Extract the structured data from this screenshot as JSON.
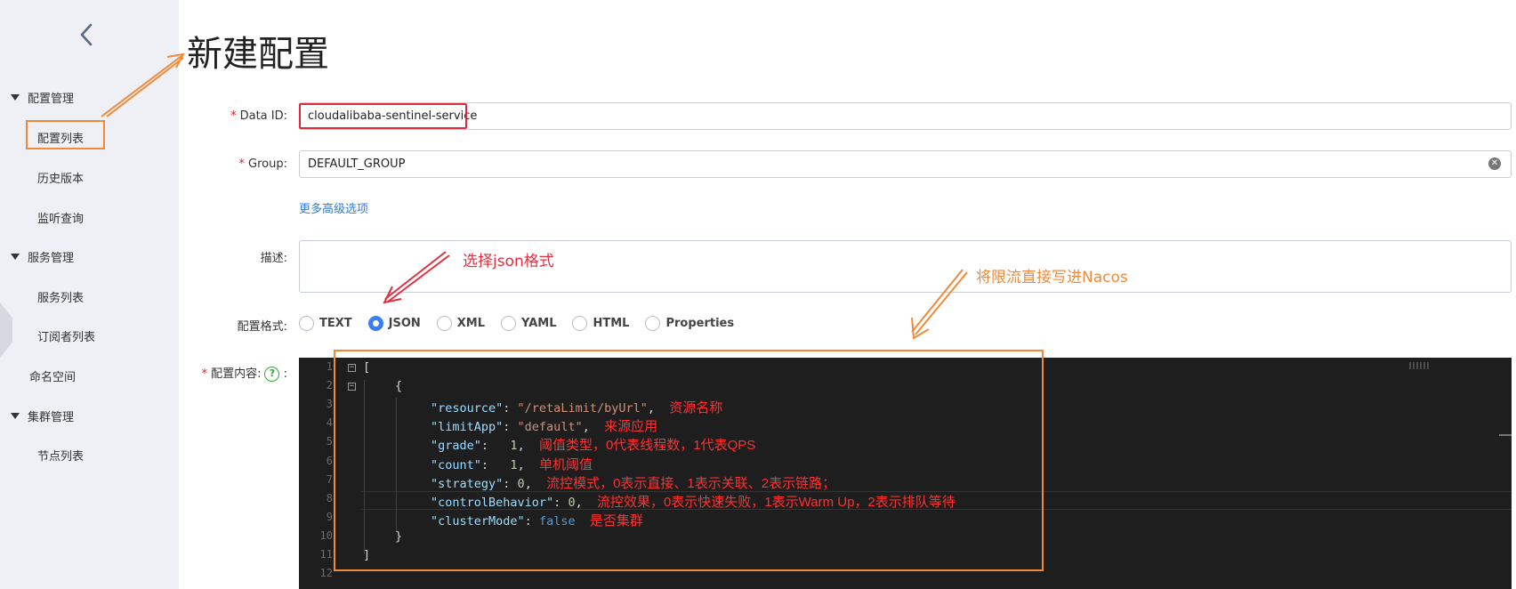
{
  "sidebar": {
    "groups": [
      {
        "label": "配置管理",
        "items": [
          "配置列表",
          "历史版本",
          "监听查询"
        ]
      },
      {
        "label": "服务管理",
        "items": [
          "服务列表",
          "订阅者列表"
        ]
      },
      {
        "label": "命名空间"
      },
      {
        "label": "集群管理",
        "items": [
          "节点列表"
        ]
      }
    ]
  },
  "page": {
    "title": "新建配置"
  },
  "form": {
    "data_id_label": "Data ID:",
    "data_id_value": "cloudalibaba-sentinel-service",
    "group_label": "Group:",
    "group_value": "DEFAULT_GROUP",
    "more_options": "更多高级选项",
    "desc_label": "描述:",
    "format_label": "配置格式:",
    "formats": [
      "TEXT",
      "JSON",
      "XML",
      "YAML",
      "HTML",
      "Properties"
    ],
    "selected_format": "JSON",
    "content_label": "配置内容:",
    "help_glyph": "?",
    "colon": ":"
  },
  "editor": {
    "line_numbers": [
      "1",
      "2",
      "3",
      "4",
      "5",
      "6",
      "7",
      "8",
      "9",
      "10",
      "11",
      "12"
    ],
    "lines": [
      {
        "t": "["
      },
      {
        "t": "{"
      },
      {
        "key": "\"resource\"",
        "sep": ": ",
        "val": "\"/retaLimit/byUrl\"",
        "vc": "str",
        "end": ",",
        "c": "资源名称"
      },
      {
        "key": "\"limitApp\"",
        "sep": ": ",
        "val": "\"default\"",
        "vc": "str",
        "end": ",",
        "c": "来源应用"
      },
      {
        "key": "\"grade\"",
        "sep": ":   ",
        "val": "1",
        "vc": "num",
        "end": ",",
        "c": "阈值类型，0代表线程数，1代表QPS"
      },
      {
        "key": "\"count\"",
        "sep": ":   ",
        "val": "1",
        "vc": "num",
        "end": ",",
        "c": "单机阈值"
      },
      {
        "key": "\"strategy\"",
        "sep": ": ",
        "val": "0",
        "vc": "num",
        "end": ",",
        "c": "流控模式，0表示直接、1表示关联、2表示链路；"
      },
      {
        "key": "\"controlBehavior\"",
        "sep": ": ",
        "val": "0",
        "vc": "num",
        "end": ",",
        "c": "流控效果，0表示快速失败，1表示Warm Up，2表示排队等待"
      },
      {
        "key": "\"clusterMode\"",
        "sep": ": ",
        "val": "false",
        "vc": "kw",
        "end": "",
        "c": "是否集群"
      },
      {
        "t": "}"
      },
      {
        "t": "]"
      }
    ]
  },
  "annotations": {
    "choose_json": "选择json格式",
    "write_nacos": "将限流直接写进Nacos"
  },
  "colors": {
    "accent_orange": "#f08a3a",
    "highlight_red": "#e02a3a",
    "radio_blue": "#3b7ef0",
    "link_blue": "#2d7cd8"
  }
}
